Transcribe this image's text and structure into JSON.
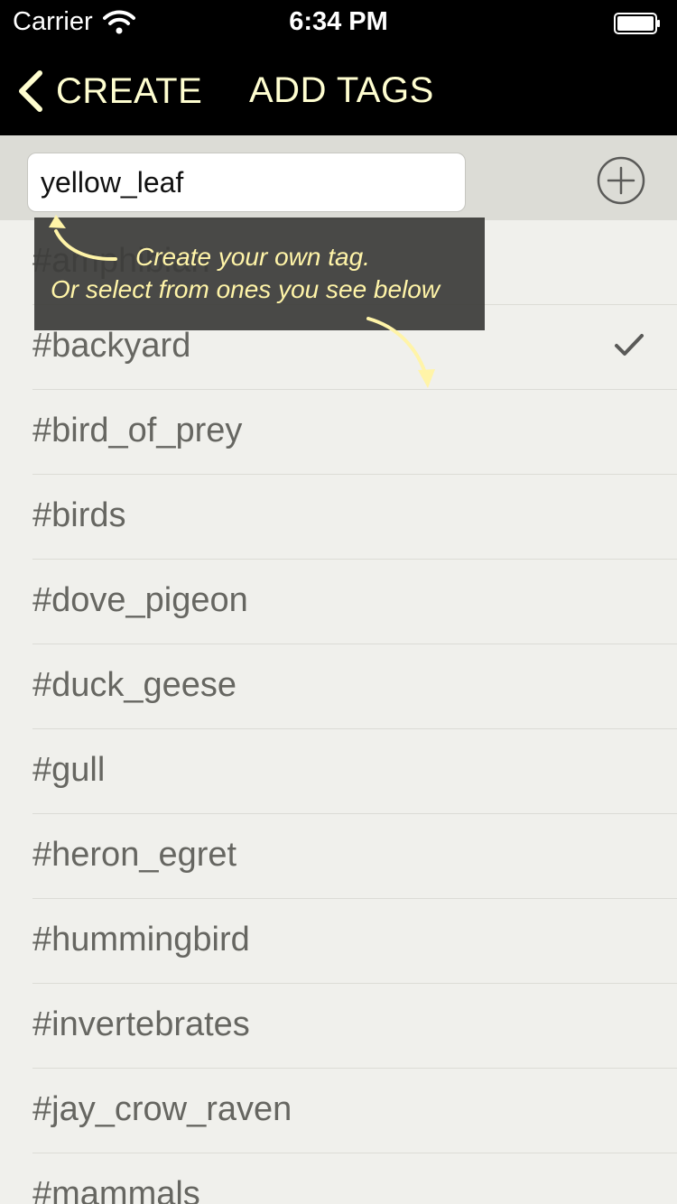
{
  "status_bar": {
    "carrier": "Carrier",
    "time": "6:34 PM",
    "wifi_icon": "wifi-icon",
    "battery_icon": "battery-icon"
  },
  "nav": {
    "back_label": "CREATE",
    "title": "ADD TAGS",
    "back_icon": "chevron-left-icon"
  },
  "input": {
    "value": "yellow_leaf",
    "add_icon": "plus-circle-icon"
  },
  "tooltip": {
    "line1": "Create your own tag.",
    "line2": "Or select from ones you see below"
  },
  "tags": [
    {
      "label": "#amphibian",
      "selected": false
    },
    {
      "label": "#backyard",
      "selected": true
    },
    {
      "label": "#bird_of_prey",
      "selected": false
    },
    {
      "label": "#birds",
      "selected": false
    },
    {
      "label": "#dove_pigeon",
      "selected": false
    },
    {
      "label": "#duck_geese",
      "selected": false
    },
    {
      "label": "#gull",
      "selected": false
    },
    {
      "label": "#heron_egret",
      "selected": false
    },
    {
      "label": "#hummingbird",
      "selected": false
    },
    {
      "label": "#invertebrates",
      "selected": false
    },
    {
      "label": "#jay_crow_raven",
      "selected": false
    },
    {
      "label": "#mammals",
      "selected": false
    }
  ],
  "colors": {
    "nav_background": "#000000",
    "nav_text": "#fffed0",
    "tooltip_text": "#fff4a8",
    "list_background": "#f0f0ec",
    "tag_text": "#666661"
  }
}
